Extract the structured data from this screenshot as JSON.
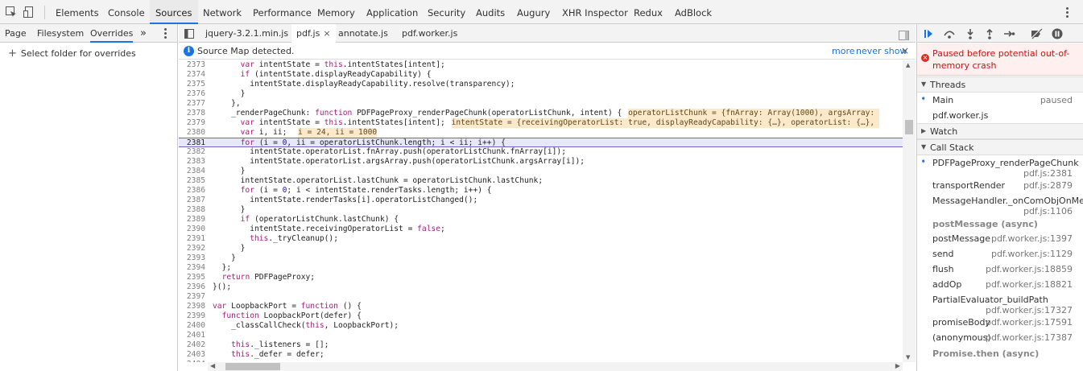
{
  "main_tabs": [
    "Elements",
    "Console",
    "Sources",
    "Network",
    "Performance",
    "Memory",
    "Application",
    "Security",
    "Audits",
    "Augury",
    "XHR Inspector",
    "Redux",
    "AdBlock"
  ],
  "nav_tabs": [
    "Page",
    "Filesystem",
    "Overrides"
  ],
  "add_folder": "Select folder for overrides",
  "file_tabs": [
    "jquery-3.2.1.min.js",
    "pdf.js",
    "annotate.js",
    "pdf.worker.js"
  ],
  "infobar": {
    "message": "Source Map detected.",
    "more": "more",
    "never": "never show"
  },
  "code_lines": [
    {
      "n": "2373",
      "t": "      var intentState = this.intentStates[intent];"
    },
    {
      "n": "2374",
      "t": "      if (intentState.displayReadyCapability) {"
    },
    {
      "n": "2375",
      "t": "        intentState.displayReadyCapability.resolve(transparency);"
    },
    {
      "n": "2376",
      "t": "      }"
    },
    {
      "n": "2377",
      "t": "    },"
    },
    {
      "n": "2378",
      "t": "    _renderPageChunk: function PDFPageProxy_renderPageChunk(operatorListChunk, intent) { ",
      "inl": "operatorListChunk = {fnArray: Array(1000), argsArray: "
    },
    {
      "n": "2379",
      "t": "      var intentState = this.intentStates[intent]; ",
      "inl": "intentState = {receivingOperatorList: true, displayReadyCapability: {…}, operatorList: {…}, "
    },
    {
      "n": "2380",
      "t": "      var i, ii;  ",
      "inl": "i = 24, ii = 1000"
    },
    {
      "n": "2381",
      "t": "      for (i = 0, ii = operatorListChunk.length; i < ii; i++) {",
      "hl": true
    },
    {
      "n": "2382",
      "t": "        intentState.operatorList.fnArray.push(operatorListChunk.fnArray[i]);"
    },
    {
      "n": "2383",
      "t": "        intentState.operatorList.argsArray.push(operatorListChunk.argsArray[i]);"
    },
    {
      "n": "2384",
      "t": "      }"
    },
    {
      "n": "2385",
      "t": "      intentState.operatorList.lastChunk = operatorListChunk.lastChunk;"
    },
    {
      "n": "2386",
      "t": "      for (i = 0; i < intentState.renderTasks.length; i++) {"
    },
    {
      "n": "2387",
      "t": "        intentState.renderTasks[i].operatorListChanged();"
    },
    {
      "n": "2388",
      "t": "      }"
    },
    {
      "n": "2389",
      "t": "      if (operatorListChunk.lastChunk) {"
    },
    {
      "n": "2390",
      "t": "        intentState.receivingOperatorList = false;"
    },
    {
      "n": "2391",
      "t": "        this._tryCleanup();"
    },
    {
      "n": "2392",
      "t": "      }"
    },
    {
      "n": "2393",
      "t": "    }"
    },
    {
      "n": "2394",
      "t": "  };"
    },
    {
      "n": "2395",
      "t": "  return PDFPageProxy;"
    },
    {
      "n": "2396",
      "t": "}();"
    },
    {
      "n": "2397",
      "t": ""
    },
    {
      "n": "2398",
      "t": "var LoopbackPort = function () {"
    },
    {
      "n": "2399",
      "t": "  function LoopbackPort(defer) {"
    },
    {
      "n": "2400",
      "t": "    _classCallCheck(this, LoopbackPort);"
    },
    {
      "n": "2401",
      "t": ""
    },
    {
      "n": "2402",
      "t": "    this._listeners = [];"
    },
    {
      "n": "2403",
      "t": "    this._defer = defer;"
    },
    {
      "n": "2404",
      "t": ""
    }
  ],
  "paused_message": "Paused before potential out-of-memory crash",
  "threads": {
    "label": "Threads",
    "items": [
      {
        "name": "Main",
        "status": "paused"
      },
      {
        "name": "pdf.worker.js",
        "status": ""
      }
    ]
  },
  "watch_label": "Watch",
  "call_stack": {
    "label": "Call Stack",
    "frames": [
      {
        "name": "PDFPageProxy_renderPageChunk",
        "loc": "pdf.js:2381",
        "two": true
      },
      {
        "name": "transportRender",
        "loc": "pdf.js:2879",
        "two": false
      },
      {
        "name": "MessageHandler._onComObjOnMes…",
        "loc": "pdf.js:1106",
        "two": true
      }
    ],
    "async1": "postMessage (async)",
    "frames2": [
      {
        "name": "postMessage",
        "loc": "pdf.worker.js:1397"
      },
      {
        "name": "send",
        "loc": "pdf.worker.js:1129"
      },
      {
        "name": "flush",
        "loc": "pdf.worker.js:18859"
      },
      {
        "name": "addOp",
        "loc": "pdf.worker.js:18821"
      }
    ],
    "frame_two": {
      "name": "PartialEvaluator_buildPath",
      "loc": "pdf.worker.js:17327"
    },
    "frames3": [
      {
        "name": "promiseBody",
        "loc": "pdf.worker.js:17591"
      },
      {
        "name": "(anonymous)",
        "loc": "pdf.worker.js:17387"
      }
    ],
    "async2": "Promise.then (async)"
  }
}
